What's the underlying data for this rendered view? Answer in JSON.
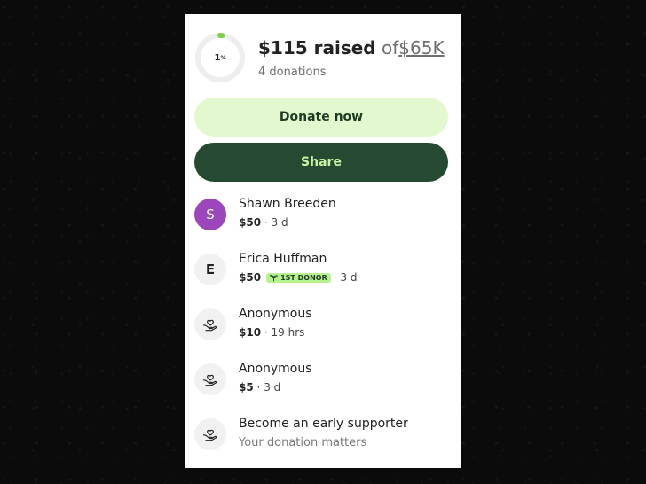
{
  "summary": {
    "progress_label": "1",
    "progress_suffix": "%",
    "progress_fraction": 0.01,
    "raised": "$115 raised",
    "of_text": "of",
    "goal": "$65K",
    "donation_count": "4 donations"
  },
  "buttons": {
    "donate_label": "Donate now",
    "share_label": "Share"
  },
  "donors": [
    {
      "initial": "S",
      "name": "Shawn Breeden",
      "amount": "$50",
      "time": "3 d"
    },
    {
      "initial": "E",
      "name": "Erica Huffman",
      "amount": "$50",
      "badge": "1ST DONOR",
      "time": "3 d"
    },
    {
      "name": "Anonymous",
      "amount": "$10",
      "time": "19 hrs",
      "icon": "heart-hand-icon"
    },
    {
      "name": "Anonymous",
      "amount": "$5",
      "time": "3 d",
      "icon": "heart-hand-icon"
    }
  ],
  "cta": {
    "title": "Become an early supporter",
    "subtitle": "Your donation matters",
    "icon": "heart-hand-icon"
  },
  "separator": "·",
  "colors": {
    "progress": "#7cd14b",
    "donate_bg": "#e3f8cf",
    "share_bg": "#264a31",
    "share_text": "#c8f3a6",
    "badge_bg": "#b7f08f",
    "avatar_purple": "#9b46bb"
  }
}
